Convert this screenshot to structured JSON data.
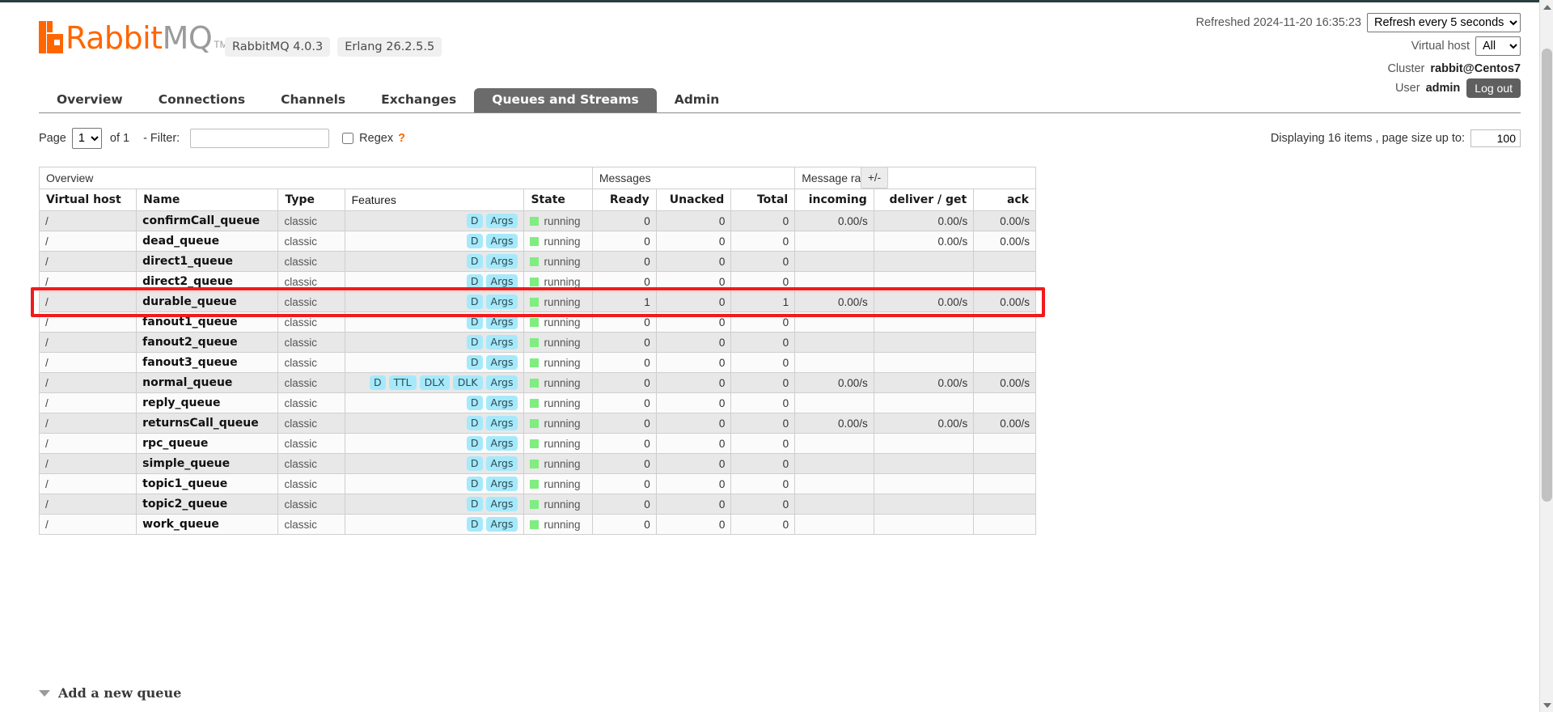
{
  "brand": {
    "name_rabbit": "Rabbit",
    "name_mq": "MQ",
    "tm": "TM",
    "version_badges": [
      "RabbitMQ 4.0.3",
      "Erlang 26.2.5.5"
    ]
  },
  "header": {
    "refreshed_label": "Refreshed 2024-11-20 16:35:23",
    "refresh_select_value": "Refresh every 5 seconds",
    "refresh_options": [
      "Refresh every 5 seconds"
    ],
    "vhost_label": "Virtual host",
    "vhost_value": "All",
    "vhost_options": [
      "All"
    ],
    "cluster_label": "Cluster",
    "cluster_name": "rabbit@Centos7",
    "user_label": "User",
    "user_name": "admin",
    "logout_label": "Log out"
  },
  "tabs": [
    {
      "label": "Overview",
      "active": false
    },
    {
      "label": "Connections",
      "active": false
    },
    {
      "label": "Channels",
      "active": false
    },
    {
      "label": "Exchanges",
      "active": false
    },
    {
      "label": "Queues and Streams",
      "active": true
    },
    {
      "label": "Admin",
      "active": false
    }
  ],
  "filterbar": {
    "page_label": "Page",
    "page_value": "1",
    "page_options": [
      "1"
    ],
    "of_label": "of 1",
    "filter_label": "- Filter:",
    "filter_value": "",
    "filter_placeholder": "",
    "regex_label": "Regex",
    "regex_help": "?",
    "regex_checked": false,
    "displaying_text": "Displaying 16 items , page size up to:",
    "page_size_value": "100"
  },
  "table": {
    "group_headers": [
      {
        "label": "Overview",
        "span": 5
      },
      {
        "label": "Messages",
        "span": 3
      },
      {
        "label": "Message rates",
        "span": 3
      }
    ],
    "plusminus_label": "+/-",
    "columns": [
      {
        "label": "Virtual host",
        "sortable": true,
        "align": "left"
      },
      {
        "label": "Name",
        "sortable": true,
        "align": "left"
      },
      {
        "label": "Type",
        "sortable": true,
        "align": "left"
      },
      {
        "label": "Features",
        "sortable": false,
        "align": "left"
      },
      {
        "label": "State",
        "sortable": true,
        "align": "left"
      },
      {
        "label": "Ready",
        "sortable": true,
        "align": "right"
      },
      {
        "label": "Unacked",
        "sortable": true,
        "align": "right"
      },
      {
        "label": "Total",
        "sortable": true,
        "align": "right"
      },
      {
        "label": "incoming",
        "sortable": true,
        "align": "right"
      },
      {
        "label": "deliver / get",
        "sortable": true,
        "align": "right"
      },
      {
        "label": "ack",
        "sortable": true,
        "align": "right"
      }
    ],
    "rows": [
      {
        "vhost": "/",
        "name": "confirmCall_queue",
        "type": "classic",
        "features": [
          "D",
          "Args"
        ],
        "state": "running",
        "ready": "0",
        "unacked": "0",
        "total": "0",
        "incoming": "0.00/s",
        "deliver_get": "0.00/s",
        "ack": "0.00/s",
        "highlighted": false
      },
      {
        "vhost": "/",
        "name": "dead_queue",
        "type": "classic",
        "features": [
          "D",
          "Args"
        ],
        "state": "running",
        "ready": "0",
        "unacked": "0",
        "total": "0",
        "incoming": "",
        "deliver_get": "0.00/s",
        "ack": "0.00/s",
        "highlighted": false
      },
      {
        "vhost": "/",
        "name": "direct1_queue",
        "type": "classic",
        "features": [
          "D",
          "Args"
        ],
        "state": "running",
        "ready": "0",
        "unacked": "0",
        "total": "0",
        "incoming": "",
        "deliver_get": "",
        "ack": "",
        "highlighted": false
      },
      {
        "vhost": "/",
        "name": "direct2_queue",
        "type": "classic",
        "features": [
          "D",
          "Args"
        ],
        "state": "running",
        "ready": "0",
        "unacked": "0",
        "total": "0",
        "incoming": "",
        "deliver_get": "",
        "ack": "",
        "highlighted": false
      },
      {
        "vhost": "/",
        "name": "durable_queue",
        "type": "classic",
        "features": [
          "D",
          "Args"
        ],
        "state": "running",
        "ready": "1",
        "unacked": "0",
        "total": "1",
        "incoming": "0.00/s",
        "deliver_get": "0.00/s",
        "ack": "0.00/s",
        "highlighted": true
      },
      {
        "vhost": "/",
        "name": "fanout1_queue",
        "type": "classic",
        "features": [
          "D",
          "Args"
        ],
        "state": "running",
        "ready": "0",
        "unacked": "0",
        "total": "0",
        "incoming": "",
        "deliver_get": "",
        "ack": "",
        "highlighted": false
      },
      {
        "vhost": "/",
        "name": "fanout2_queue",
        "type": "classic",
        "features": [
          "D",
          "Args"
        ],
        "state": "running",
        "ready": "0",
        "unacked": "0",
        "total": "0",
        "incoming": "",
        "deliver_get": "",
        "ack": "",
        "highlighted": false
      },
      {
        "vhost": "/",
        "name": "fanout3_queue",
        "type": "classic",
        "features": [
          "D",
          "Args"
        ],
        "state": "running",
        "ready": "0",
        "unacked": "0",
        "total": "0",
        "incoming": "",
        "deliver_get": "",
        "ack": "",
        "highlighted": false
      },
      {
        "vhost": "/",
        "name": "normal_queue",
        "type": "classic",
        "features": [
          "D",
          "TTL",
          "DLX",
          "DLK",
          "Args"
        ],
        "state": "running",
        "ready": "0",
        "unacked": "0",
        "total": "0",
        "incoming": "0.00/s",
        "deliver_get": "0.00/s",
        "ack": "0.00/s",
        "highlighted": false
      },
      {
        "vhost": "/",
        "name": "reply_queue",
        "type": "classic",
        "features": [
          "D",
          "Args"
        ],
        "state": "running",
        "ready": "0",
        "unacked": "0",
        "total": "0",
        "incoming": "",
        "deliver_get": "",
        "ack": "",
        "highlighted": false
      },
      {
        "vhost": "/",
        "name": "returnsCall_queue",
        "type": "classic",
        "features": [
          "D",
          "Args"
        ],
        "state": "running",
        "ready": "0",
        "unacked": "0",
        "total": "0",
        "incoming": "0.00/s",
        "deliver_get": "0.00/s",
        "ack": "0.00/s",
        "highlighted": false
      },
      {
        "vhost": "/",
        "name": "rpc_queue",
        "type": "classic",
        "features": [
          "D",
          "Args"
        ],
        "state": "running",
        "ready": "0",
        "unacked": "0",
        "total": "0",
        "incoming": "",
        "deliver_get": "",
        "ack": "",
        "highlighted": false
      },
      {
        "vhost": "/",
        "name": "simple_queue",
        "type": "classic",
        "features": [
          "D",
          "Args"
        ],
        "state": "running",
        "ready": "0",
        "unacked": "0",
        "total": "0",
        "incoming": "",
        "deliver_get": "",
        "ack": "",
        "highlighted": false
      },
      {
        "vhost": "/",
        "name": "topic1_queue",
        "type": "classic",
        "features": [
          "D",
          "Args"
        ],
        "state": "running",
        "ready": "0",
        "unacked": "0",
        "total": "0",
        "incoming": "",
        "deliver_get": "",
        "ack": "",
        "highlighted": false
      },
      {
        "vhost": "/",
        "name": "topic2_queue",
        "type": "classic",
        "features": [
          "D",
          "Args"
        ],
        "state": "running",
        "ready": "0",
        "unacked": "0",
        "total": "0",
        "incoming": "",
        "deliver_get": "",
        "ack": "",
        "highlighted": false
      },
      {
        "vhost": "/",
        "name": "work_queue",
        "type": "classic",
        "features": [
          "D",
          "Args"
        ],
        "state": "running",
        "ready": "0",
        "unacked": "0",
        "total": "0",
        "incoming": "",
        "deliver_get": "",
        "ack": "",
        "highlighted": false
      }
    ]
  },
  "footer": {
    "add_queue_label": "Add a new queue"
  },
  "colors": {
    "brand_orange": "#ff6600",
    "active_tab_bg": "#6b6b6b",
    "badge_bg": "#a6e9fb",
    "state_running": "#80ed80",
    "highlight_red": "#f11b1b"
  }
}
